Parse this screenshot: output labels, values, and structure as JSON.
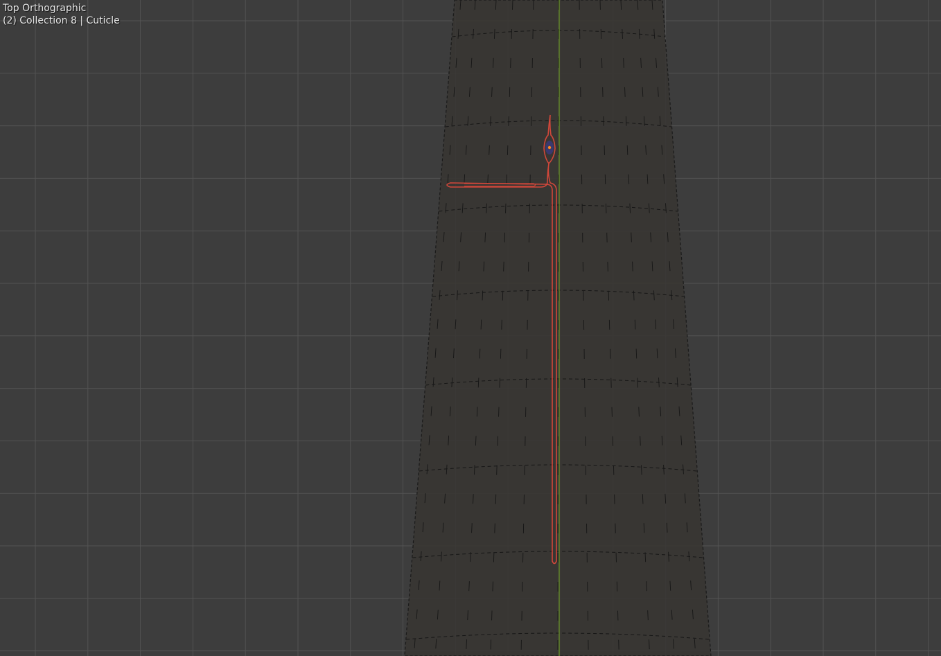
{
  "viewport": {
    "view_name": "Top Orthographic",
    "object_info": "(2) Collection 8 | Cuticle"
  },
  "colors": {
    "background": "#3d3d3d",
    "grid_minor": "#474747",
    "grid_major": "#545454",
    "mesh_fill": "#383532",
    "mesh_edge": "#161616",
    "y_axis": "#6e9a2a",
    "selected_outline": "#d2473a",
    "object_origin": "#ff8a1a",
    "origin_fill": "#3a3a7a"
  },
  "icons": {
    "origin": "object-origin-dot"
  }
}
